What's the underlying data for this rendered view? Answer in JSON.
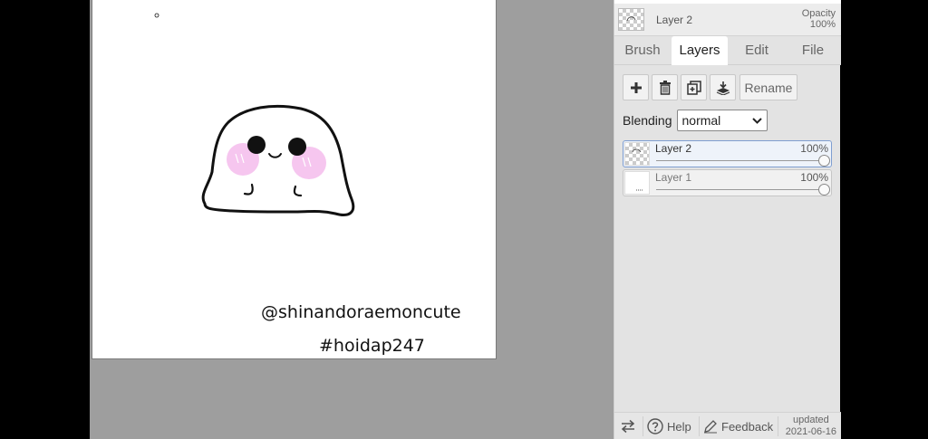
{
  "canvas": {
    "watermark_handle": "@shinandoraemoncute",
    "watermark_tag": "#hoidap247",
    "colors": {
      "ink": "#111111",
      "blush": "#f6c6ef"
    }
  },
  "current_layer": {
    "name": "Layer 2",
    "opacity_label": "Opacity",
    "opacity_value": "100%"
  },
  "tabs": [
    {
      "label": "Brush",
      "active": false
    },
    {
      "label": "Layers",
      "active": true
    },
    {
      "label": "Edit",
      "active": false
    },
    {
      "label": "File",
      "active": false
    }
  ],
  "layer_tools": {
    "add_icon": "plus-icon",
    "delete_icon": "trash-icon",
    "duplicate_icon": "duplicate-icon",
    "merge_icon": "merge-down-icon",
    "rename_label": "Rename"
  },
  "blending": {
    "label": "Blending",
    "selected": "normal"
  },
  "layers": [
    {
      "name": "Layer 2",
      "opacity": "100%",
      "active": true
    },
    {
      "name": "Layer 1",
      "opacity": "100%",
      "active": false
    }
  ],
  "footer": {
    "swap_icon": "swap-arrows-icon",
    "help_label": "Help",
    "feedback_label": "Feedback",
    "updated_label": "updated",
    "updated_date": "2021-06-16"
  },
  "colors": {
    "panel_bg": "#e3e3e3",
    "workspace_bg": "#9e9e9e",
    "active_layer_border": "#7f9ed0"
  }
}
